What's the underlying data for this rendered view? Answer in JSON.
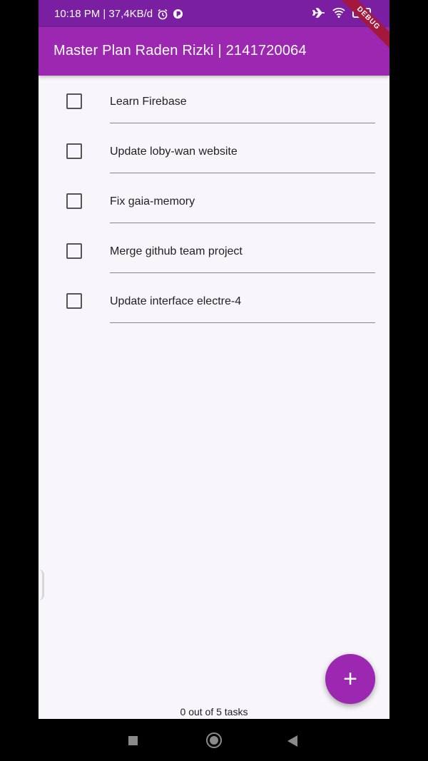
{
  "status_bar": {
    "time_speed": "10:18 PM | 37,4KB/d",
    "icons": [
      "alarm-icon",
      "app-notification-icon",
      "airplane-icon",
      "wifi-icon",
      "battery-icon"
    ],
    "battery_level": "38"
  },
  "app_bar": {
    "title": "Master Plan Raden Rizki | 2141720064",
    "color": "#9c27b0"
  },
  "debug_banner": "DEBUG",
  "tasks": [
    {
      "label": "Learn Firebase",
      "completed": false
    },
    {
      "label": "Update loby-wan website",
      "completed": false
    },
    {
      "label": "Fix gaia-memory",
      "completed": false
    },
    {
      "label": "Merge github team project",
      "completed": false
    },
    {
      "label": "Update interface electre-4",
      "completed": false
    }
  ],
  "footer": {
    "count_text": "0 out of 5 tasks"
  },
  "fab": {
    "icon": "plus-icon",
    "label": "+"
  },
  "nav_bar": {
    "buttons": [
      "recents-icon",
      "home-icon",
      "back-icon"
    ]
  }
}
